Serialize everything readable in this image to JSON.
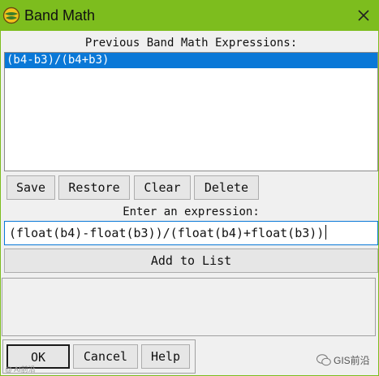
{
  "window": {
    "title": "Band Math",
    "icon": "envi-globe-icon",
    "close_glyph": "✕"
  },
  "previous": {
    "label": "Previous Band Math Expressions:",
    "items": [
      "(b4-b3)/(b4+b3)"
    ]
  },
  "list_buttons": {
    "save": "Save",
    "restore": "Restore",
    "clear": "Clear",
    "delete": "Delete"
  },
  "expression": {
    "label": "Enter an expression:",
    "value": "(float(b4)-float(b3))/(float(b4)+float(b3))"
  },
  "add_to_list": "Add to List",
  "bottom_buttons": {
    "ok": "OK",
    "cancel": "Cancel",
    "help": "Help"
  },
  "watermark": {
    "left": "@ AI前沿",
    "right": "GIS前沿"
  },
  "colors": {
    "titlebar": "#7dbd1e",
    "selection": "#0a78d7"
  }
}
